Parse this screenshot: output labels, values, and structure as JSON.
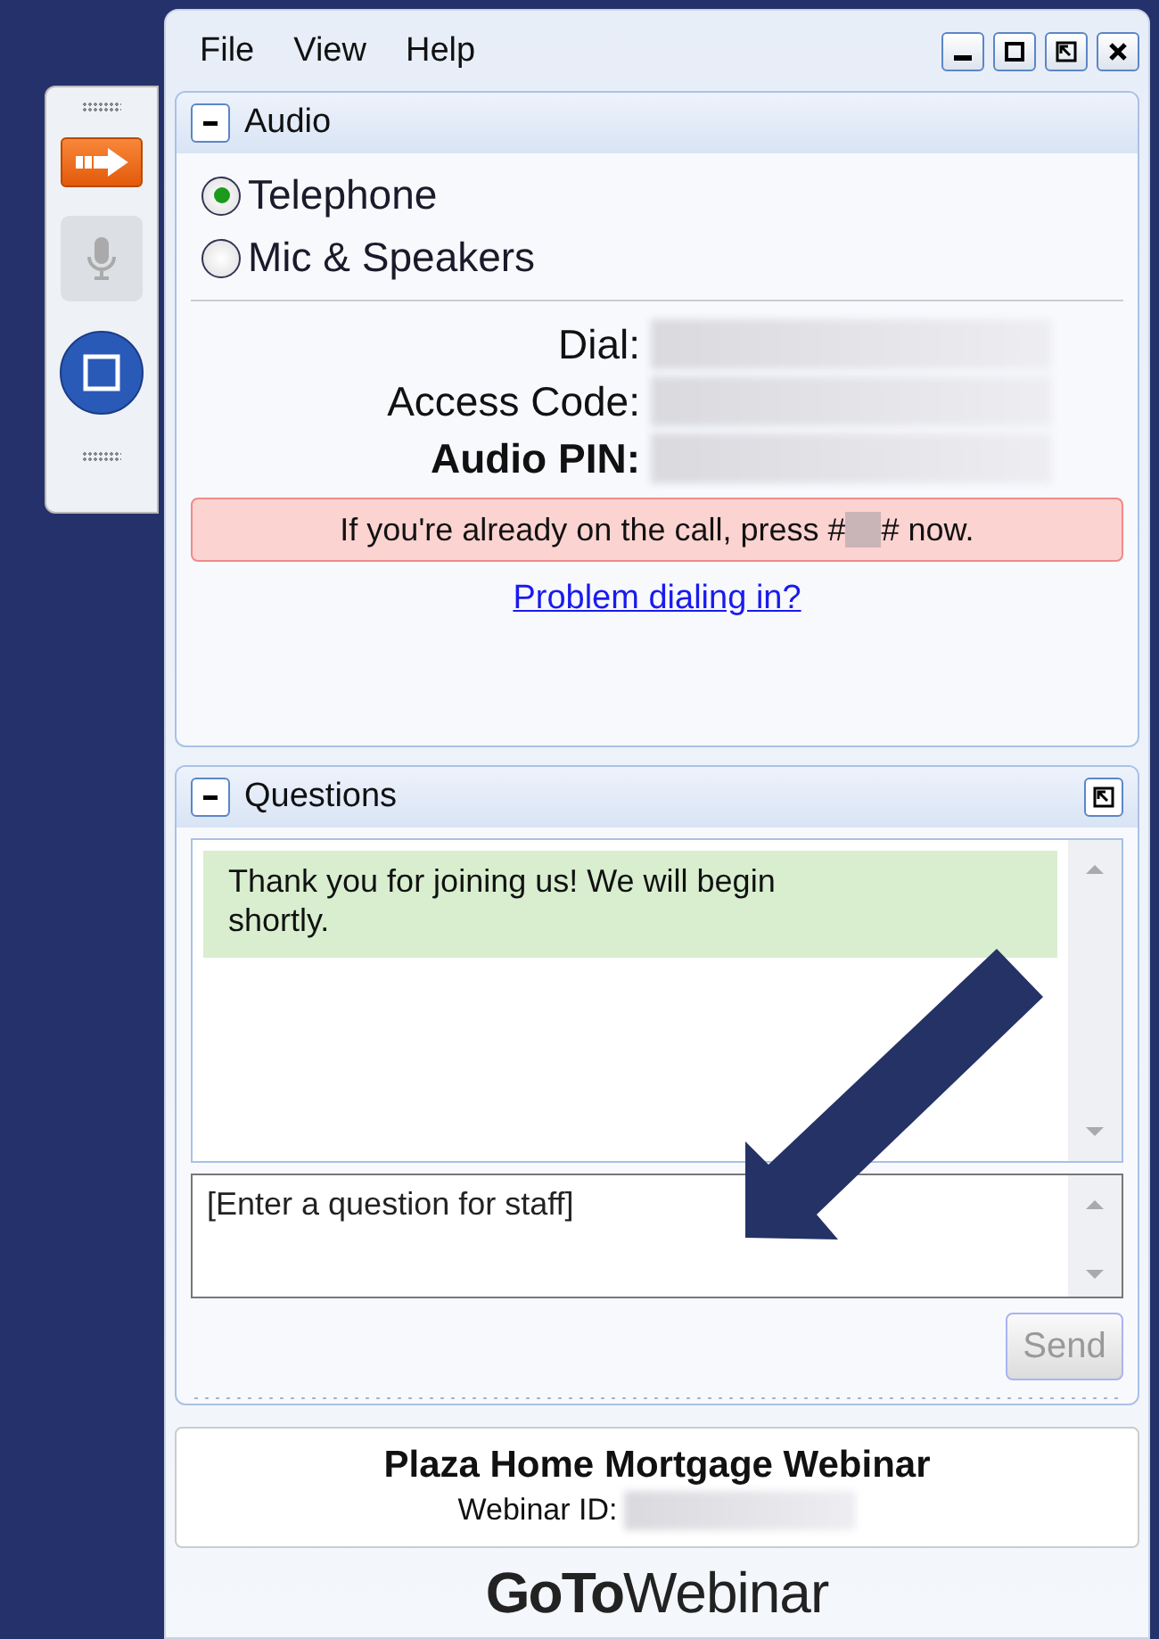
{
  "menu": [
    "File",
    "View",
    "Help"
  ],
  "audio": {
    "title": "Audio",
    "options": [
      {
        "label": "Telephone",
        "selected": true
      },
      {
        "label": "Mic & Speakers",
        "selected": false
      }
    ],
    "fields": [
      {
        "label": "Dial:",
        "emphasized": false
      },
      {
        "label": "Access Code:",
        "emphasized": false
      },
      {
        "label": "Audio PIN:",
        "emphasized": true
      }
    ],
    "notice": {
      "before": "If you're already on the call, press #",
      "after": "# now."
    },
    "link": "Problem dialing in?"
  },
  "questions": {
    "title": "Questions",
    "messages": [
      {
        "text": "Thank you for joining us! We will begin shortly."
      }
    ],
    "input": {
      "placeholder": "[Enter a question for staff]"
    },
    "send": {
      "label": "Send",
      "disabled": true
    }
  },
  "webinar": {
    "title": "Plaza Home Mortgage Webinar",
    "id_label": "Webinar ID:"
  },
  "brand": "**GoTo**Webinar"
}
